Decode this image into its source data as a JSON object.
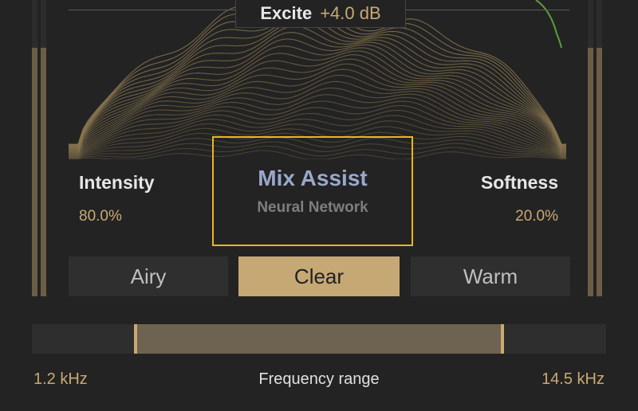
{
  "header": {
    "label": "Excite",
    "value": "+4.0 dB"
  },
  "params": {
    "intensity": {
      "label": "Intensity",
      "value": "80.0%"
    },
    "softness": {
      "label": "Softness",
      "value": "20.0%"
    }
  },
  "mix_assist": {
    "title": "Mix Assist",
    "subtitle": "Neural Network"
  },
  "presets": [
    {
      "label": "Airy",
      "active": false
    },
    {
      "label": "Clear",
      "active": true
    },
    {
      "label": "Warm",
      "active": false
    }
  ],
  "frequency": {
    "low": "1.2 kHz",
    "label": "Frequency range",
    "high": "14.5 kHz",
    "low_fraction": 0.18,
    "high_fraction": 0.82
  },
  "colors": {
    "accent": "#c9aa71",
    "focus": "#f0b220",
    "assist_text": "#9aa8cc",
    "spectrum_line": "#8a7750",
    "spectrum_highlight": "#5a9e3a"
  }
}
